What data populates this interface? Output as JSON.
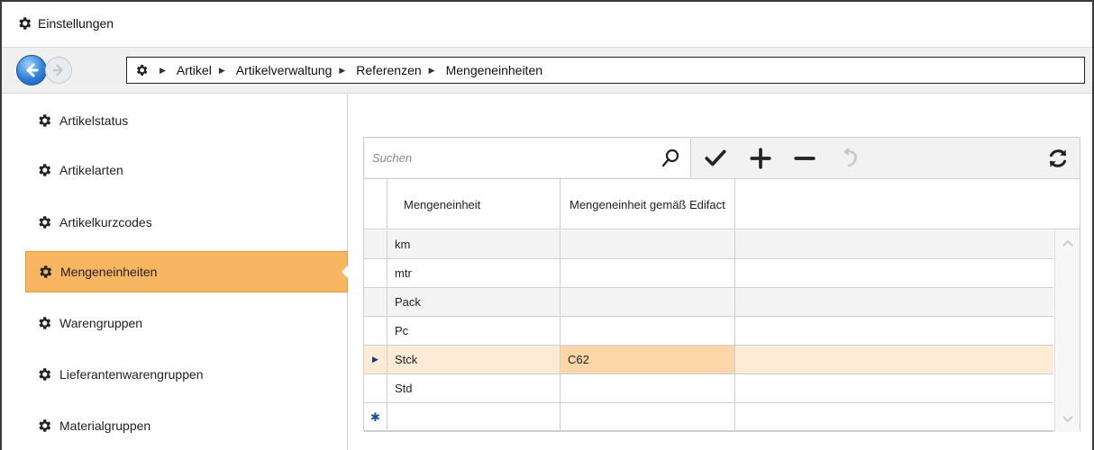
{
  "window": {
    "title": "Einstellungen"
  },
  "breadcrumb": [
    "Artikel",
    "Artikelverwaltung",
    "Referenzen",
    "Mengeneinheiten"
  ],
  "sidebar": {
    "items": [
      {
        "label": "Artikelstatus"
      },
      {
        "label": "Artikelarten"
      },
      {
        "label": "Artikelkurzcodes"
      },
      {
        "label": "Mengeneinheiten",
        "active": true
      },
      {
        "label": "Warengruppen"
      },
      {
        "label": "Lieferantenwarengruppen"
      },
      {
        "label": "Materialgruppen"
      }
    ]
  },
  "toolbar": {
    "search_placeholder": "Suchen",
    "buttons": [
      "search-icon",
      "check-icon",
      "plus-icon",
      "minus-icon",
      "undo-icon",
      "refresh-icon"
    ]
  },
  "table": {
    "columns": [
      "Mengeneinheit",
      "Mengeneinheit gemäß Edifact"
    ],
    "rows": [
      {
        "c1": "km",
        "c2": ""
      },
      {
        "c1": "mtr",
        "c2": ""
      },
      {
        "c1": "Pack",
        "c2": ""
      },
      {
        "c1": "Pc",
        "c2": ""
      },
      {
        "c1": "Stck",
        "c2": "C62",
        "selected": true
      },
      {
        "c1": "Std",
        "c2": ""
      },
      {
        "c1": "",
        "c2": "",
        "new": true
      }
    ]
  },
  "colors": {
    "accent": "#f8b662",
    "selected_row": "#fdebd6",
    "selected_cell": "#fbd6a9"
  }
}
